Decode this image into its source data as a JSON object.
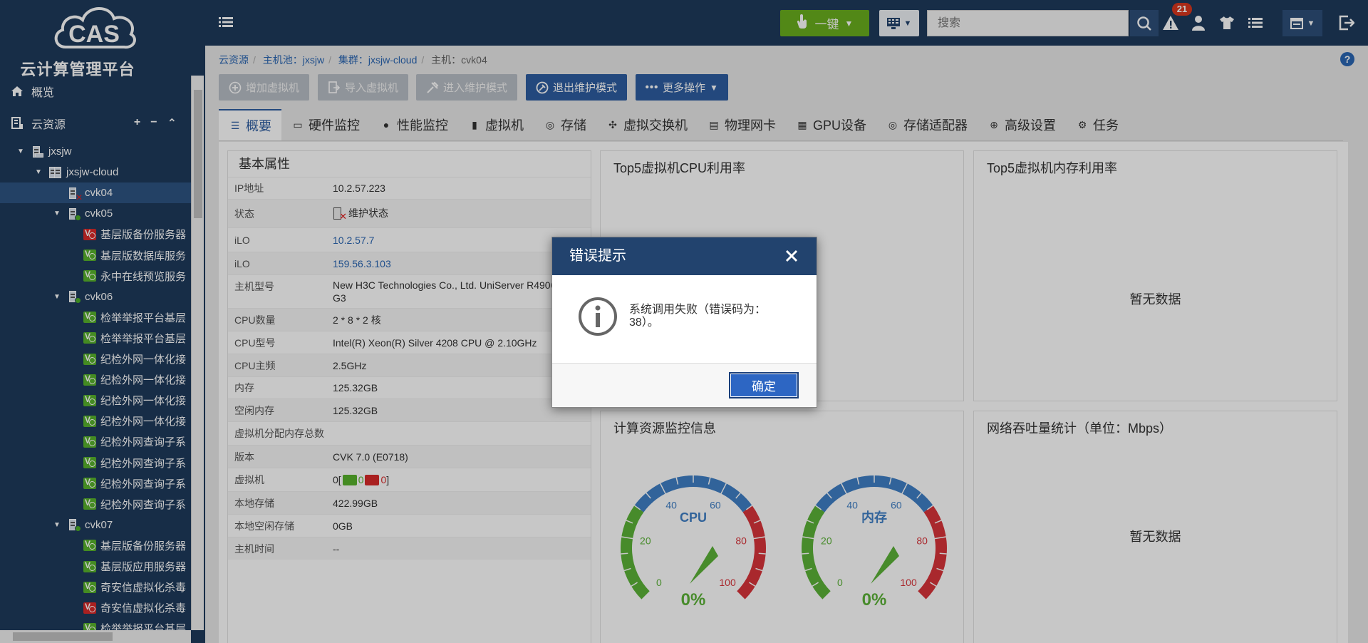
{
  "app": {
    "logo_text": "CAS",
    "subtitle": "云计算管理平台"
  },
  "nav": {
    "overview": "概览",
    "cloud_resources": "云资源",
    "tools": [
      "+",
      "−",
      "⌃"
    ]
  },
  "tree": [
    {
      "label": "jxsjw",
      "level": 0,
      "kind": "hostpool",
      "expanded": true
    },
    {
      "label": "jxsjw-cloud",
      "level": 1,
      "kind": "cluster",
      "expanded": true
    },
    {
      "label": "cvk04",
      "level": 2,
      "kind": "host-err",
      "selected": true
    },
    {
      "label": "cvk05",
      "level": 2,
      "kind": "host-ok",
      "expanded": true
    },
    {
      "label": "基层版备份服务器",
      "level": 3,
      "kind": "vm-stop"
    },
    {
      "label": "基层版数据库服务",
      "level": 3,
      "kind": "vm-run"
    },
    {
      "label": "永中在线预览服务",
      "level": 3,
      "kind": "vm-run"
    },
    {
      "label": "cvk06",
      "level": 2,
      "kind": "host-ok",
      "expanded": true
    },
    {
      "label": "检举举报平台基层",
      "level": 3,
      "kind": "vm-run"
    },
    {
      "label": "检举举报平台基层",
      "level": 3,
      "kind": "vm-run"
    },
    {
      "label": "纪检外网一体化接",
      "level": 3,
      "kind": "vm-run"
    },
    {
      "label": "纪检外网一体化接",
      "level": 3,
      "kind": "vm-run"
    },
    {
      "label": "纪检外网一体化接",
      "level": 3,
      "kind": "vm-run"
    },
    {
      "label": "纪检外网一体化接",
      "level": 3,
      "kind": "vm-run"
    },
    {
      "label": "纪检外网查询子系",
      "level": 3,
      "kind": "vm-run"
    },
    {
      "label": "纪检外网查询子系",
      "level": 3,
      "kind": "vm-run"
    },
    {
      "label": "纪检外网查询子系",
      "level": 3,
      "kind": "vm-run"
    },
    {
      "label": "纪检外网查询子系",
      "level": 3,
      "kind": "vm-run"
    },
    {
      "label": "cvk07",
      "level": 2,
      "kind": "host-ok",
      "expanded": true
    },
    {
      "label": "基层版备份服务器",
      "level": 3,
      "kind": "vm-run"
    },
    {
      "label": "基层版应用服务器",
      "level": 3,
      "kind": "vm-run"
    },
    {
      "label": "奇安信虚拟化杀毒",
      "level": 3,
      "kind": "vm-run"
    },
    {
      "label": "奇安信虚拟化杀毒",
      "level": 3,
      "kind": "vm-stop"
    },
    {
      "label": "检举举报平台基层",
      "level": 3,
      "kind": "vm-run"
    }
  ],
  "topbar": {
    "onekey_label": "一键",
    "search_placeholder": "搜索",
    "alert_count": "21"
  },
  "breadcrumb": [
    {
      "text": "云资源",
      "link": true
    },
    {
      "text": "主机池：jxsjw",
      "link": true
    },
    {
      "text": "集群：jxsjw-cloud",
      "link": true
    },
    {
      "text": "主机：cvk04",
      "link": false
    }
  ],
  "actions": [
    {
      "label": "增加虚拟机",
      "icon": "plus-circle-icon",
      "enabled": false
    },
    {
      "label": "导入虚拟机",
      "icon": "import-icon",
      "enabled": false
    },
    {
      "label": "进入维护模式",
      "icon": "wrench-icon",
      "enabled": false
    },
    {
      "label": "退出维护模式",
      "icon": "exit-maintenance-icon",
      "enabled": true
    },
    {
      "label": "更多操作",
      "icon": "ellipsis-icon",
      "enabled": true
    }
  ],
  "tabs": [
    {
      "label": "概要",
      "icon": "list-icon",
      "active": true
    },
    {
      "label": "硬件监控",
      "icon": "monitor-icon"
    },
    {
      "label": "性能监控",
      "icon": "pin-icon"
    },
    {
      "label": "虚拟机",
      "icon": "vm-icon"
    },
    {
      "label": "存储",
      "icon": "database-icon"
    },
    {
      "label": "虚拟交换机",
      "icon": "switch-icon"
    },
    {
      "label": "物理网卡",
      "icon": "nic-icon"
    },
    {
      "label": "GPU设备",
      "icon": "chip-icon"
    },
    {
      "label": "存储适配器",
      "icon": "database-icon"
    },
    {
      "label": "高级设置",
      "icon": "up-circle-icon"
    },
    {
      "label": "任务",
      "icon": "gear-icon"
    }
  ],
  "basic": {
    "title": "基本属性",
    "rows": [
      {
        "key": "IP地址",
        "value": "10.2.57.223"
      },
      {
        "key": "状态",
        "value": "维护状态",
        "type": "status"
      },
      {
        "key": "iLO",
        "value": "10.2.57.7",
        "type": "link"
      },
      {
        "key": "iLO",
        "value": "159.56.3.103",
        "type": "link"
      },
      {
        "key": "主机型号",
        "value": "New H3C Technologies Co., Ltd. UniServer R4900",
        "value2": "G3"
      },
      {
        "key": "CPU数量",
        "value": "2 * 8 * 2 核"
      },
      {
        "key": "CPU型号",
        "value": "Intel(R) Xeon(R) Silver 4208 CPU @ 2.10GHz"
      },
      {
        "key": "CPU主频",
        "value": "2.5GHz"
      },
      {
        "key": "内存",
        "value": "125.32GB"
      },
      {
        "key": "空闲内存",
        "value": "125.32GB"
      },
      {
        "key": "虚拟机分配内存总数",
        "value": ""
      },
      {
        "key": "版本",
        "value": "CVK 7.0 (E0718)"
      },
      {
        "key": "虚拟机",
        "value": "0",
        "type": "vmcount",
        "running": "0",
        "stopped": "0"
      },
      {
        "key": "本地存储",
        "value": "422.99GB"
      },
      {
        "key": "本地空闲存储",
        "value": "0GB"
      },
      {
        "key": "主机时间",
        "value": "--"
      }
    ]
  },
  "panels": {
    "cpu_top5_title": "Top5虚拟机CPU利用率",
    "mem_top5_title": "Top5虚拟机内存利用率",
    "compute_title": "计算资源监控信息",
    "net_title": "网络吞吐量统计（单位：Mbps）",
    "no_data": "暂无数据"
  },
  "gauges": [
    {
      "label": "CPU",
      "value": 0,
      "display": "0%",
      "ticks": [
        "0",
        "20",
        "40",
        "60",
        "80",
        "100"
      ]
    },
    {
      "label": "内存",
      "value": 0,
      "display": "0%",
      "ticks": [
        "0",
        "20",
        "40",
        "60",
        "80",
        "100"
      ]
    }
  ],
  "colors": {
    "sidebar": "#1e3a5c",
    "brand_blue": "#2d5da1",
    "green": "#6aaf1e",
    "gauge_green": "#5cb338",
    "gauge_blue": "#3f7fc6",
    "gauge_red": "#d9343a"
  },
  "dialog": {
    "title": "错误提示",
    "message": "系统调用失败（错误码为：38）。",
    "ok_label": "确定"
  }
}
